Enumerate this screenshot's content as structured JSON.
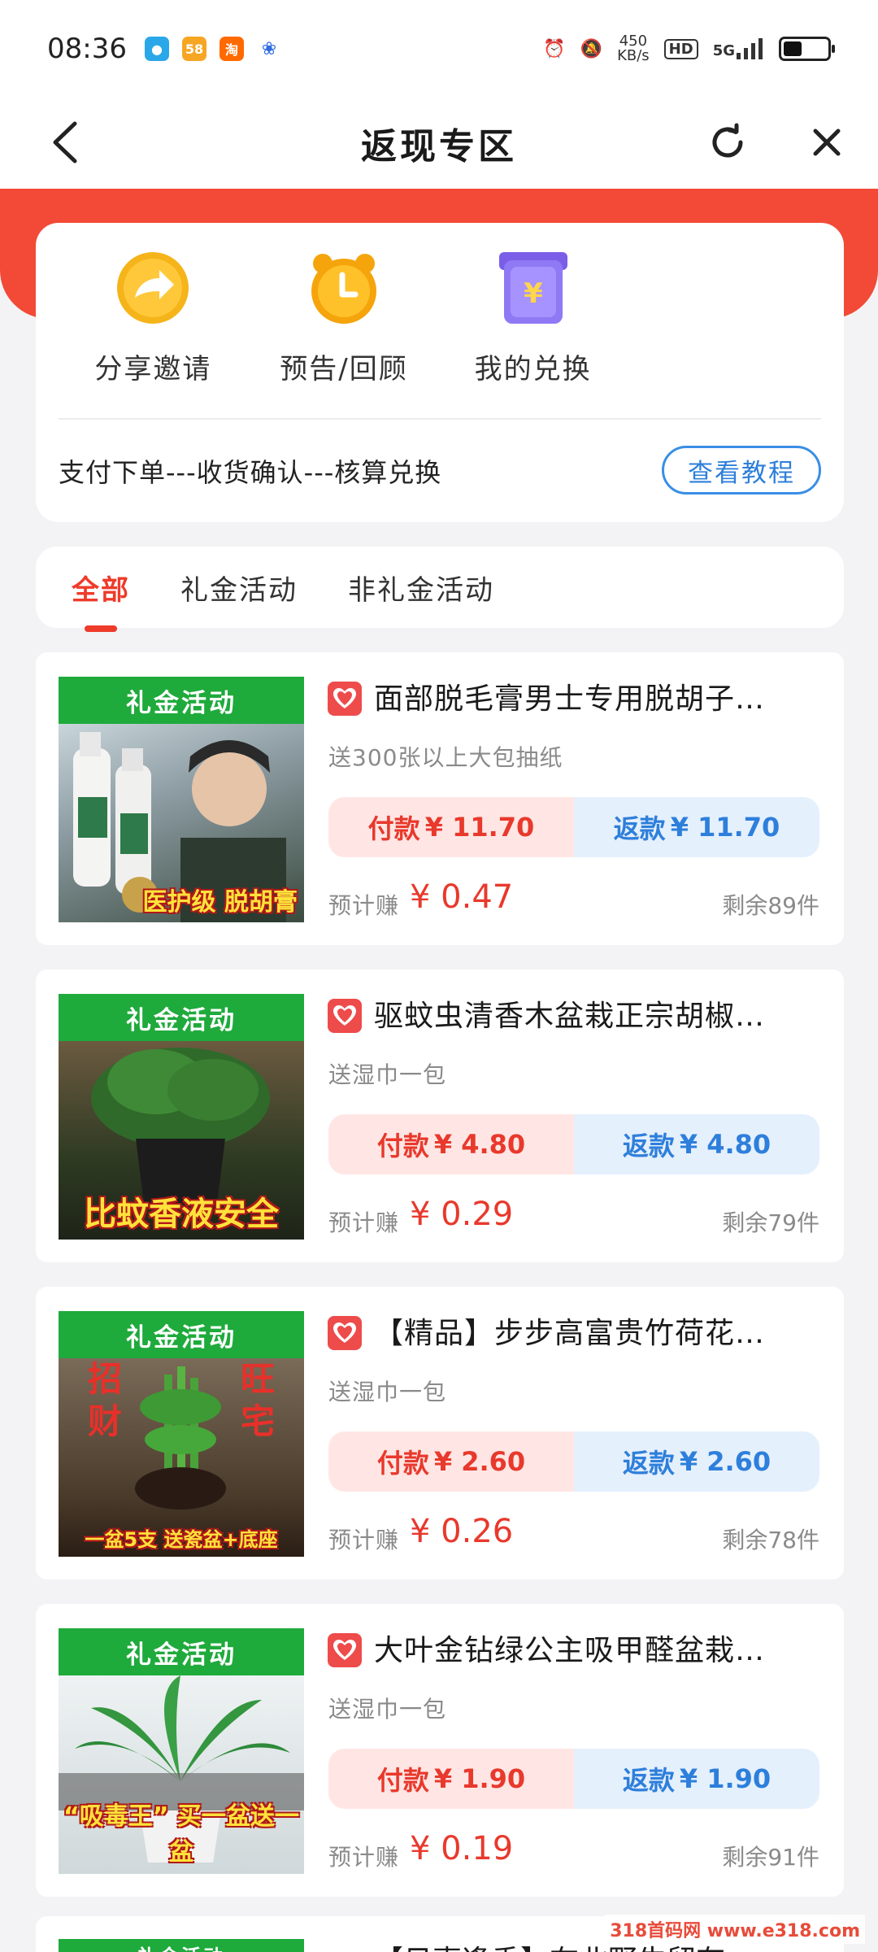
{
  "status_bar": {
    "time": "08:36",
    "apps": [
      {
        "icon": "wechat-app-icon",
        "text": "",
        "color": "#2aa7e8"
      },
      {
        "icon": "58-app-icon",
        "text": "58",
        "color": "#f6a623"
      },
      {
        "icon": "taobao-app-icon",
        "text": "淘",
        "color": "#ff6a00"
      },
      {
        "icon": "baidu-app-icon",
        "text": "",
        "color": "#2f6de0"
      }
    ],
    "net_speed_value": "450",
    "net_speed_unit": "KB/s",
    "hd": "HD",
    "network": "5G"
  },
  "nav": {
    "title": "返现专区"
  },
  "quick_actions": [
    {
      "label": "分享邀请",
      "icon": "share-arrow-icon",
      "color": "#f5b419"
    },
    {
      "label": "预告/回顾",
      "icon": "alarm-clock-icon",
      "color": "#f5a40c"
    },
    {
      "label": "我的兑换",
      "icon": "yuan-exchange-icon",
      "color": "#8a6df2"
    }
  ],
  "flow": {
    "text": "支付下单---收货确认---核算兑换",
    "tutorial_button": "查看教程"
  },
  "tabs": [
    {
      "label": "全部",
      "active": true
    },
    {
      "label": "礼金活动",
      "active": false
    },
    {
      "label": "非礼金活动",
      "active": false
    }
  ],
  "products": [
    {
      "tag": "礼金活动",
      "title": "面部脱毛膏男士专用脱胡子…",
      "gift": "送300张以上大包抽纸",
      "pay_label": "付款",
      "pay_price": "¥ 11.70",
      "refund_label": "返款",
      "refund_price": "¥ 11.70",
      "earn_label": "预计赚",
      "earn_value": "¥ 0.47",
      "stock": "剩余89件",
      "image_text": "医护级 脱胡膏",
      "image_bg": "#7f8e93"
    },
    {
      "tag": "礼金活动",
      "title": "驱蚊虫清香木盆栽正宗胡椒…",
      "gift": "送湿巾一包",
      "pay_label": "付款",
      "pay_price": "¥ 4.80",
      "refund_label": "返款",
      "refund_price": "¥ 4.80",
      "earn_label": "预计赚",
      "earn_value": "¥ 0.29",
      "stock": "剩余79件",
      "image_text": "比蚊香液安全",
      "image_bg": "#2f4a2c"
    },
    {
      "tag": "礼金活动",
      "title": "【精品】步步高富贵竹荷花…",
      "gift": "送湿巾一包",
      "pay_label": "付款",
      "pay_price": "¥ 2.60",
      "refund_label": "返款",
      "refund_price": "¥ 2.60",
      "earn_label": "预计赚",
      "earn_value": "¥ 0.26",
      "stock": "剩余78件",
      "image_text": "一盆5支 送瓷盆+底座",
      "image_bg": "#4a3a2a"
    },
    {
      "tag": "礼金活动",
      "title": "大叶金钻绿公主吸甲醛盆栽…",
      "gift": "送湿巾一包",
      "pay_label": "付款",
      "pay_price": "¥ 1.90",
      "refund_label": "返款",
      "refund_price": "¥ 1.90",
      "earn_label": "预计赚",
      "earn_value": "¥ 0.19",
      "stock": "剩余91件",
      "image_text": "“吸毒王” 买一盆送一盆",
      "image_bg": "#dfe6e8"
    }
  ],
  "partial_product": {
    "tag": "礼金活动",
    "title": "【日事逢香】在北野牛留有"
  },
  "watermark": "318首码网 www.e318.com",
  "colors": {
    "accent_red": "#ee3b2b",
    "banner_red": "#f24a36",
    "tag_green": "#1faa3c",
    "link_blue": "#2d7fd9"
  }
}
